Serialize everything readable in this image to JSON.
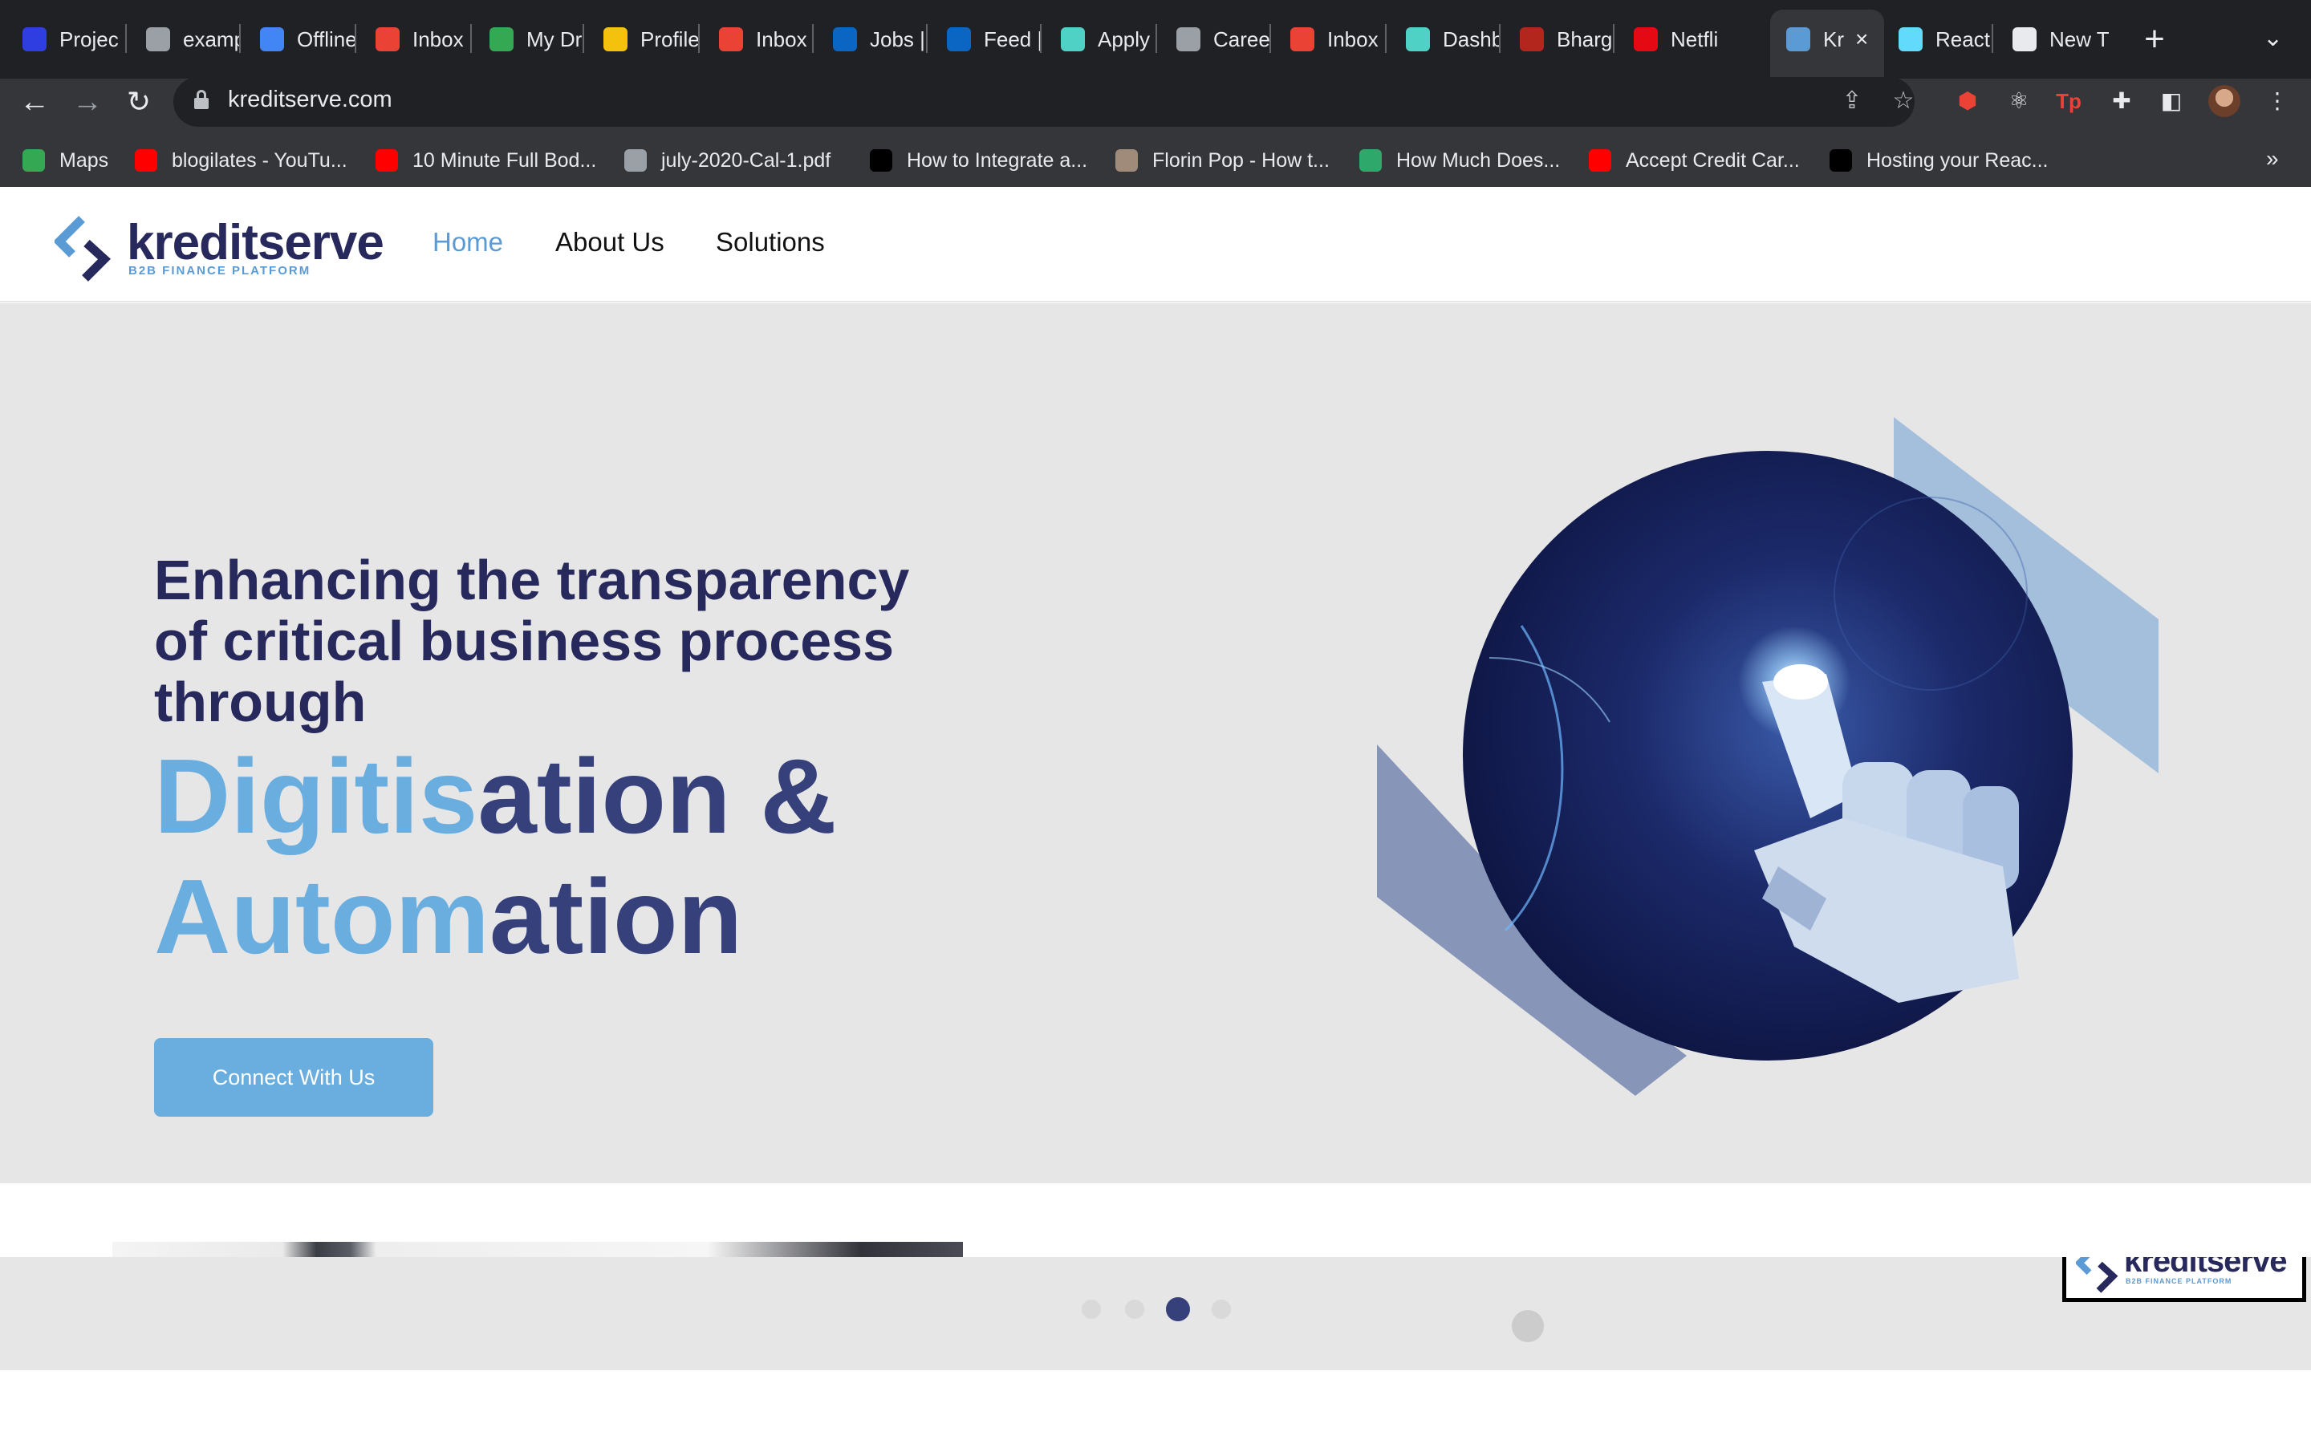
{
  "browser": {
    "tabs": [
      {
        "label": "Projec",
        "icon": "u-icon",
        "color": "#2f3ee0"
      },
      {
        "label": "examp",
        "icon": "globe-icon",
        "color": "#9aa0a6"
      },
      {
        "label": "Offline",
        "icon": "docs-icon",
        "color": "#4285f4"
      },
      {
        "label": "Inbox",
        "icon": "gmail-icon",
        "color": "#ea4335"
      },
      {
        "label": "My Dr",
        "icon": "drive-icon",
        "color": "#34a853"
      },
      {
        "label": "Profile",
        "icon": "profile-icon",
        "color": "#f4c20d"
      },
      {
        "label": "Inbox",
        "icon": "gmail-icon",
        "color": "#ea4335"
      },
      {
        "label": "Jobs |",
        "icon": "linkedin-icon",
        "color": "#0a66c2"
      },
      {
        "label": "Feed |",
        "icon": "linkedin-icon",
        "color": "#0a66c2"
      },
      {
        "label": "Apply",
        "icon": "wolf-icon",
        "color": "#4fd1c5"
      },
      {
        "label": "Caree",
        "icon": "apple-icon",
        "color": "#9aa0a6"
      },
      {
        "label": "Inbox",
        "icon": "gmail-icon",
        "color": "#ea4335"
      },
      {
        "label": "Dashb",
        "icon": "wolf-icon",
        "color": "#4fd1c5"
      },
      {
        "label": "Bharg",
        "icon": "pen-icon",
        "color": "#b3261e"
      },
      {
        "label": "Netfli",
        "icon": "netflix-icon",
        "color": "#e50914"
      },
      {
        "label": "Kr",
        "icon": "kreditserve-icon",
        "color": "#5b9bd5",
        "active": true
      },
      {
        "label": "React",
        "icon": "react-icon",
        "color": "#61dafb"
      },
      {
        "label": "New T",
        "icon": "chrome-icon",
        "color": "#e8eaed"
      }
    ],
    "url": "kreditserve.com",
    "bookmarks": [
      {
        "label": "Maps",
        "icon": "maps-icon",
        "color": "#34a853"
      },
      {
        "label": "blogilates - YouTu...",
        "icon": "youtube-icon",
        "color": "#ff0000"
      },
      {
        "label": "10 Minute Full Bod...",
        "icon": "youtube-icon",
        "color": "#ff0000"
      },
      {
        "label": "july-2020-Cal-1.pdf",
        "icon": "globe-icon",
        "color": "#9aa0a6"
      },
      {
        "label": "How to Integrate a...",
        "icon": "lambda-icon",
        "color": "#000000"
      },
      {
        "label": "Florin Pop - How t...",
        "icon": "avatar-icon",
        "color": "#a08a7a"
      },
      {
        "label": "How Much Does...",
        "icon": "leaf-icon",
        "color": "#2fa86b"
      },
      {
        "label": "Accept Credit Car...",
        "icon": "youtube-icon",
        "color": "#ff0000"
      },
      {
        "label": "Hosting your Reac...",
        "icon": "medium-icon",
        "color": "#000000"
      }
    ]
  },
  "site": {
    "logo": {
      "word": "kreditserve",
      "tagline": "B2B FINANCE PLATFORM"
    },
    "nav": [
      {
        "label": "Home",
        "active": true
      },
      {
        "label": "About Us",
        "active": false
      },
      {
        "label": "Solutions",
        "active": false
      }
    ],
    "hero": {
      "line1": "Enhancing the transparency",
      "line2": "of critical business process",
      "line3": "through",
      "big1_light": "Digitis",
      "big1_dark": "ation &",
      "big2_light": "Autom",
      "big2_dark": "ation",
      "cta": "Connect With Us"
    },
    "slider": {
      "count": 4,
      "active_index": 2
    },
    "chat_logo": {
      "word": "kreditserve",
      "tagline": "B2B FINANCE PLATFORM"
    }
  },
  "colors": {
    "brand_dark": "#27285c",
    "brand_light": "#6aaee0",
    "hero_bg": "#e6e6e6"
  }
}
